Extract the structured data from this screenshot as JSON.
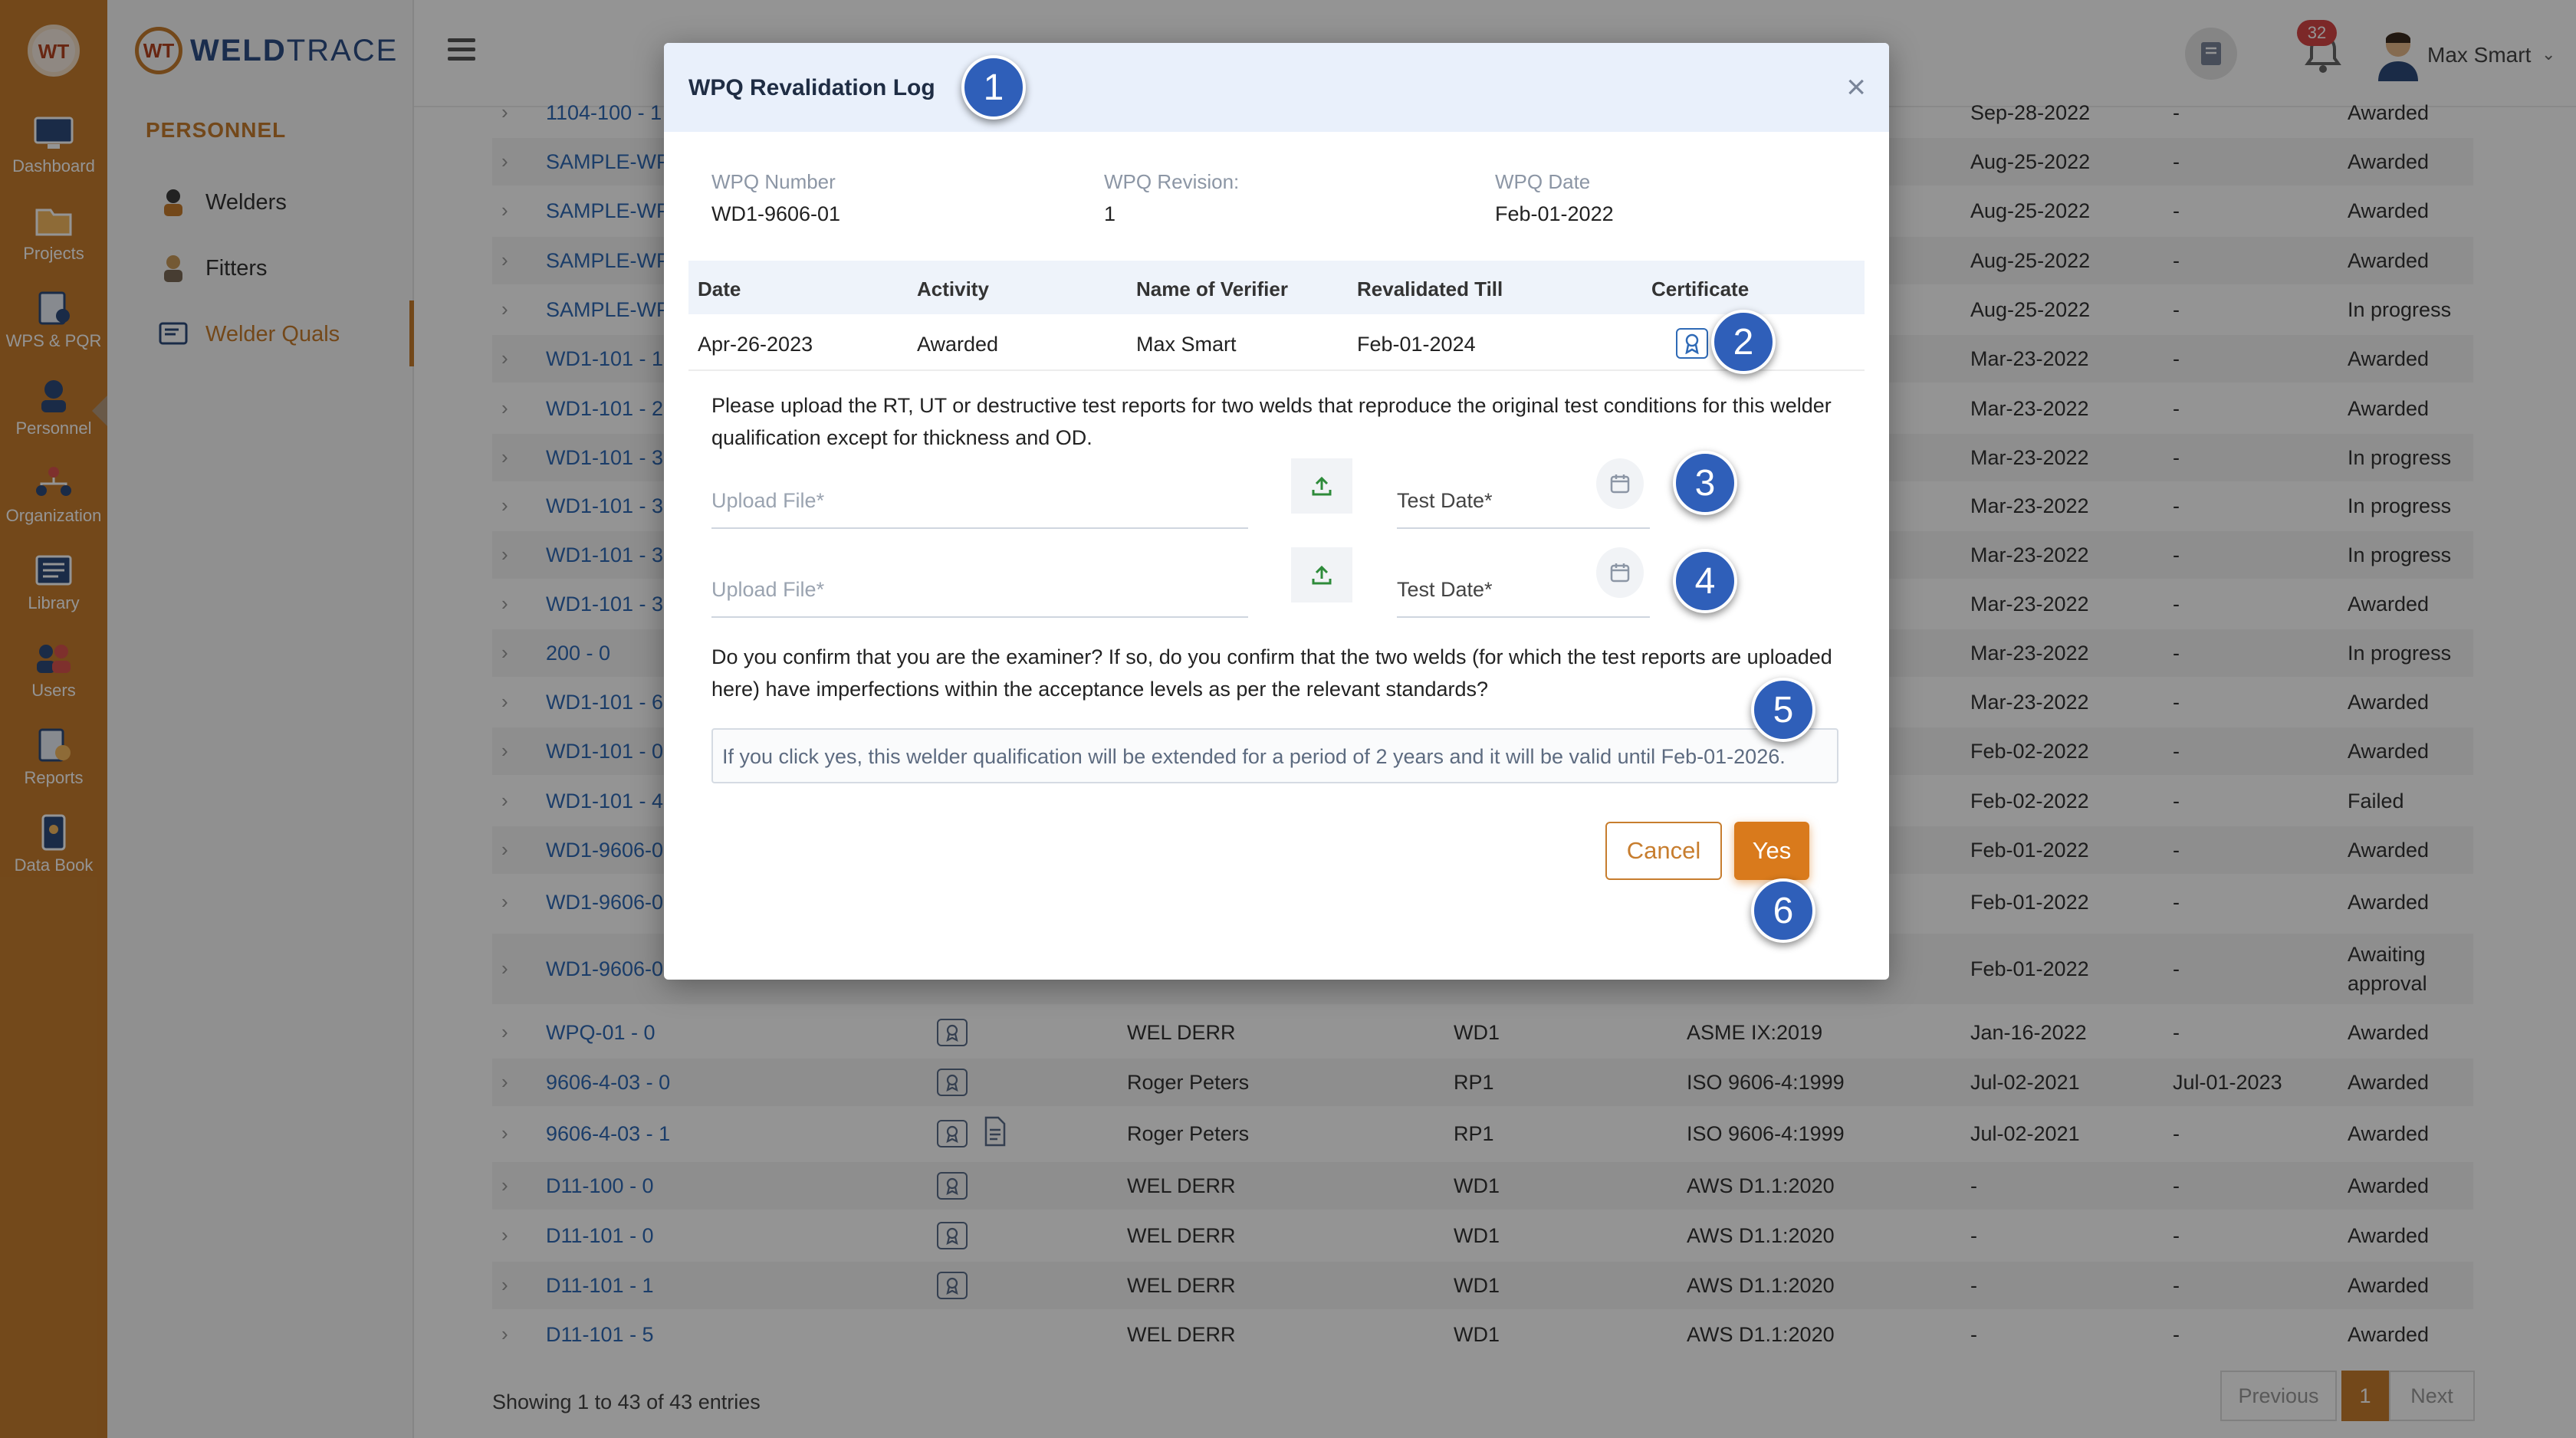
{
  "rail": {
    "logo_text": "WT",
    "items": [
      {
        "label": "Dashboard",
        "icon": "dashboard-icon"
      },
      {
        "label": "Projects",
        "icon": "projects-icon"
      },
      {
        "label": "WPS & PQR",
        "icon": "wps-pqr-icon"
      },
      {
        "label": "Personnel",
        "icon": "personnel-icon"
      },
      {
        "label": "Organization",
        "icon": "organization-icon"
      },
      {
        "label": "Library",
        "icon": "library-icon"
      },
      {
        "label": "Users",
        "icon": "users-icon"
      },
      {
        "label": "Reports",
        "icon": "reports-icon"
      },
      {
        "label": "Data Book",
        "icon": "data-book-icon"
      }
    ]
  },
  "brand": {
    "mark": "WT",
    "name_bold": "WELD",
    "name_light": "TRACE"
  },
  "subnav": {
    "section": "PERSONNEL",
    "items": [
      {
        "label": "Welders",
        "icon": "welder-icon"
      },
      {
        "label": "Fitters",
        "icon": "fitter-icon"
      },
      {
        "label": "Welder Quals",
        "icon": "welder-quals-icon"
      }
    ]
  },
  "header": {
    "notification_count": "32",
    "user_name": "Max Smart",
    "chevron": "⌄"
  },
  "table": {
    "rows": [
      {
        "id": "1104-100 - 1",
        "icons": [],
        "name": "",
        "code": "",
        "std": "",
        "date": "Sep-28-2022",
        "exp": "-",
        "status": "Awarded"
      },
      {
        "id": "SAMPLE-WPQ",
        "icons": [],
        "name": "",
        "code": "",
        "std": "",
        "date": "Aug-25-2022",
        "exp": "-",
        "status": "Awarded"
      },
      {
        "id": "SAMPLE-WPQ",
        "icons": [],
        "name": "",
        "code": "",
        "std": "",
        "date": "Aug-25-2022",
        "exp": "-",
        "status": "Awarded"
      },
      {
        "id": "SAMPLE-WPQ",
        "icons": [],
        "name": "",
        "code": "",
        "std": "",
        "date": "Aug-25-2022",
        "exp": "-",
        "status": "Awarded"
      },
      {
        "id": "SAMPLE-WPQ",
        "icons": [],
        "name": "",
        "code": "",
        "std": "",
        "date": "Aug-25-2022",
        "exp": "-",
        "status": "In progress"
      },
      {
        "id": "WD1-101 - 1",
        "icons": [],
        "name": "",
        "code": "",
        "std": "",
        "date": "Mar-23-2022",
        "exp": "-",
        "status": "Awarded"
      },
      {
        "id": "WD1-101 - 2",
        "icons": [],
        "name": "",
        "code": "",
        "std": "",
        "date": "Mar-23-2022",
        "exp": "-",
        "status": "Awarded"
      },
      {
        "id": "WD1-101 - 3",
        "icons": [],
        "name": "",
        "code": "",
        "std": "",
        "date": "Mar-23-2022",
        "exp": "-",
        "status": "In progress"
      },
      {
        "id": "WD1-101 - 3",
        "icons": [],
        "name": "",
        "code": "",
        "std": "",
        "date": "Mar-23-2022",
        "exp": "-",
        "status": "In progress"
      },
      {
        "id": "WD1-101 - 3",
        "icons": [],
        "name": "",
        "code": "",
        "std": "",
        "date": "Mar-23-2022",
        "exp": "-",
        "status": "In progress"
      },
      {
        "id": "WD1-101 - 3",
        "icons": [],
        "name": "",
        "code": "",
        "std": "",
        "date": "Mar-23-2022",
        "exp": "-",
        "status": "Awarded"
      },
      {
        "id": "200 - 0",
        "icons": [],
        "name": "",
        "code": "",
        "std": "",
        "date": "Mar-23-2022",
        "exp": "-",
        "status": "In progress"
      },
      {
        "id": "WD1-101 - 6",
        "icons": [],
        "name": "",
        "code": "",
        "std": "",
        "date": "Mar-23-2022",
        "exp": "-",
        "status": "Awarded"
      },
      {
        "id": "WD1-101 - 0",
        "icons": [],
        "name": "",
        "code": "",
        "std": "",
        "date": "Feb-02-2022",
        "exp": "-",
        "status": "Awarded"
      },
      {
        "id": "WD1-101 - 4",
        "icons": [],
        "name": "",
        "code": "",
        "std": "",
        "date": "Feb-02-2022",
        "exp": "-",
        "status": "Failed"
      },
      {
        "id": "WD1-9606-0",
        "icons": [],
        "name": "",
        "code": "",
        "std": "",
        "date": "Feb-01-2022",
        "exp": "-",
        "status": "Awarded"
      },
      {
        "id": "WD1-9606-0",
        "icons": [],
        "name": "",
        "code": "",
        "std": "",
        "date": "Feb-01-2022",
        "exp": "-",
        "status": "Awarded"
      },
      {
        "id": "WD1-9606-0",
        "icons": [],
        "name": "",
        "code": "",
        "std": "",
        "date": "Feb-01-2022",
        "exp": "-",
        "status": "Awaiting approval",
        "tall": true
      },
      {
        "id": "WPQ-01 - 0",
        "icons": [
          "certificate-icon"
        ],
        "name": "WEL DERR",
        "code": "WD1",
        "std": "ASME IX:2019",
        "date": "Jan-16-2022",
        "exp": "-",
        "status": "Awarded"
      },
      {
        "id": "9606-4-03 - 0",
        "icons": [
          "certificate-icon"
        ],
        "name": "Roger Peters",
        "code": "RP1",
        "std": "ISO 9606-4:1999",
        "date": "Jul-02-2021",
        "exp": "Jul-01-2023",
        "status": "Awarded"
      },
      {
        "id": "9606-4-03 - 1",
        "icons": [
          "certificate-icon",
          "document-icon"
        ],
        "name": "Roger Peters",
        "code": "RP1",
        "std": "ISO 9606-4:1999",
        "date": "Jul-02-2021",
        "exp": "-",
        "status": "Awarded"
      },
      {
        "id": "D11-100 - 0",
        "icons": [
          "certificate-icon"
        ],
        "name": "WEL DERR",
        "code": "WD1",
        "std": "AWS D1.1:2020",
        "date": "-",
        "exp": "-",
        "status": "Awarded"
      },
      {
        "id": "D11-101 - 0",
        "icons": [
          "certificate-icon"
        ],
        "name": "WEL DERR",
        "code": "WD1",
        "std": "AWS D1.1:2020",
        "date": "-",
        "exp": "-",
        "status": "Awarded"
      },
      {
        "id": "D11-101 - 1",
        "icons": [
          "certificate-icon"
        ],
        "name": "WEL DERR",
        "code": "WD1",
        "std": "AWS D1.1:2020",
        "date": "-",
        "exp": "-",
        "status": "Awarded"
      },
      {
        "id": "D11-101 - 5",
        "icons": [],
        "name": "WEL DERR",
        "code": "WD1",
        "std": "AWS D1.1:2020",
        "date": "-",
        "exp": "-",
        "status": "Awarded"
      }
    ],
    "footer_info": "Showing 1 to 43 of 43 entries",
    "pagination": {
      "previous": "Previous",
      "current": "1",
      "next": "Next"
    }
  },
  "modal": {
    "title": "WPQ Revalidation Log",
    "close": "×",
    "wpq_number_label": "WPQ Number",
    "wpq_number": "WD1-9606-01",
    "wpq_revision_label": "WPQ Revision:",
    "wpq_revision": "1",
    "wpq_date_label": "WPQ Date",
    "wpq_date": "Feb-01-2022",
    "log_columns": [
      "Date",
      "Activity",
      "Name of Verifier",
      "Revalidated Till",
      "Certificate"
    ],
    "log_row": {
      "date": "Apr-26-2023",
      "activity": "Awarded",
      "verifier": "Max Smart",
      "revalidated_till": "Feb-01-2024"
    },
    "upload_instruction": "Please upload the RT, UT or destructive test reports for two welds that reproduce the original test conditions for this welder qualification except for thickness and OD.",
    "upload_placeholder": "Upload File*",
    "test_date_placeholder": "Test Date*",
    "confirm_text": "Do you confirm that you are the examiner? If so, do you confirm that the two welds (for which the test reports are uploaded here) have imperfections within the acceptance levels as per the relevant standards?",
    "note": "If you click yes, this welder qualification will be extended for a period of 2 years and it will be valid until Feb-01-2026.",
    "cancel_label": "Cancel",
    "yes_label": "Yes"
  },
  "callouts": [
    "1",
    "2",
    "3",
    "4",
    "5",
    "6"
  ],
  "colors": {
    "accent": "#c77d2e",
    "link": "#2f6ab6",
    "callout": "#2f5fb9",
    "yes_button": "#d97a1c",
    "badge": "#d64545"
  }
}
